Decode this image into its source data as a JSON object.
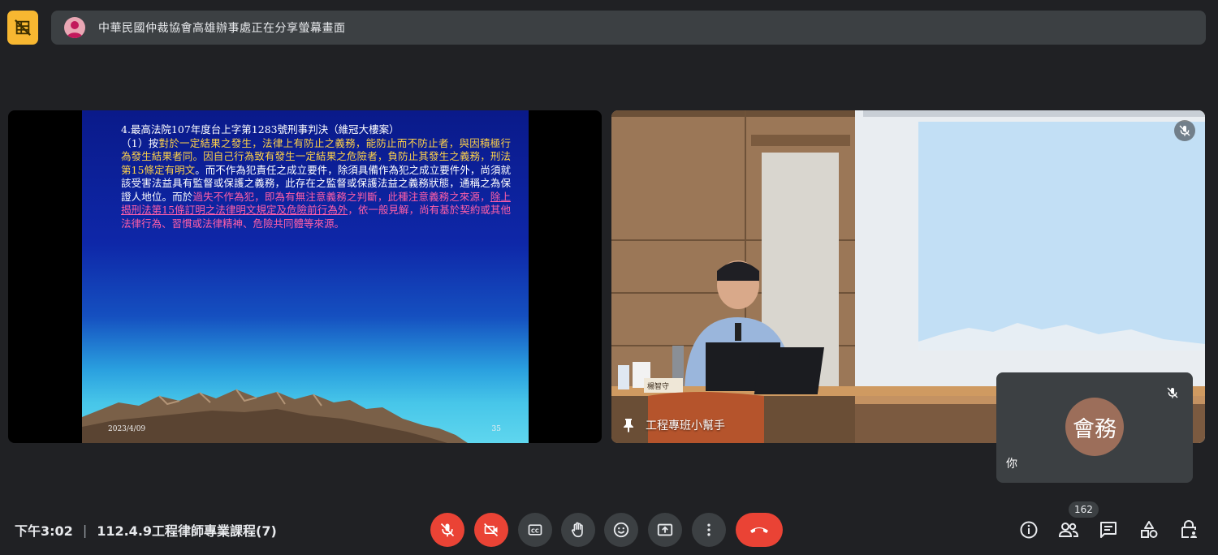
{
  "share_banner": {
    "text": "中華民國仲裁協會高雄辦事處正在分享螢幕畫面",
    "avatar_icon": "person-icon"
  },
  "slide": {
    "heading": "4.最高法院107年度台上字第1283號刑事判決（維冠大樓案）",
    "seg1": "（1）按",
    "seg2": "對於一定結果之發生，法律上有防止之義務，能防止而不防止者，與因積極行為發生結果者同。因自己行為致有發生一定結果之危險者，負防止其發生之義務，刑法第15條定有明文",
    "seg3": "。而不作為犯責任之成立要件，除須具備作為犯之成立要件外，尚須就該受害法益具有監督或保護之義務，此存在之監督或保護法益之義務狀態，通稱之為保證人地位。而於",
    "seg4": "過失不作為犯，即為有無注意義務之判斷，此種注意義務之來源，",
    "seg5": "除上揭刑法第15條訂明之法律明文規定及危險前行為外",
    "seg6": "，依一般見解，尚有基於契約或其他法律行為、習慣或法律精神、危險共同體等來源。",
    "date": "2023/4/09",
    "page": "35"
  },
  "camera": {
    "participant_label": "工程專班小幫手",
    "nameplate": "楊智守"
  },
  "self_tile": {
    "initials": "會務",
    "name": "你"
  },
  "meeting": {
    "time": "下午3:02",
    "separator": "|",
    "title": "112.4.9工程律師專業課程(7)"
  },
  "participants_count": "162",
  "colors": {
    "background": "#202124",
    "tile": "#3c4043",
    "danger": "#ea4335",
    "layout_badge": "#f7b731"
  }
}
